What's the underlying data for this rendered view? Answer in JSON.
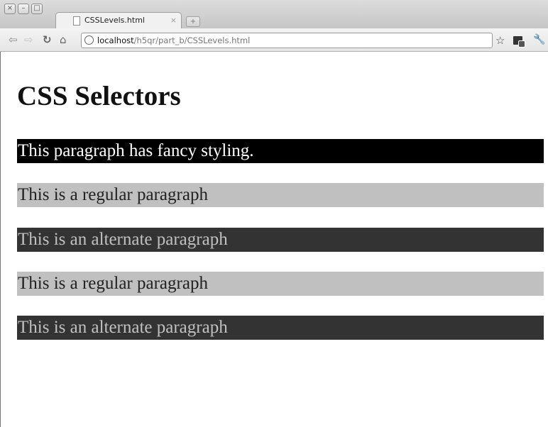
{
  "browser": {
    "tab_title": "CSSLevels.html",
    "tab_close": "×",
    "new_tab": "+",
    "url_host": "localhost",
    "url_path": "/h5qr/part_b/CSSLevels.html",
    "icons": [
      "close-window-icon",
      "minimize-window-icon",
      "maximize-window-icon",
      "page-icon",
      "back-arrow-icon",
      "forward-arrow-icon",
      "reload-icon",
      "home-icon",
      "globe-icon",
      "star-icon",
      "extension-icon",
      "wrench-icon"
    ]
  },
  "page": {
    "heading": "CSS Selectors",
    "paragraphs": [
      {
        "text": "This paragraph has fancy styling.",
        "bg": "#000000",
        "fg": "#ffffff"
      },
      {
        "text": "This is a regular paragraph",
        "bg": "#c0c0c0",
        "fg": "#222222"
      },
      {
        "text": "This is an alternate paragraph",
        "bg": "#333333",
        "fg": "#c0c0c0"
      },
      {
        "text": "This is a regular paragraph",
        "bg": "#c0c0c0",
        "fg": "#222222"
      },
      {
        "text": "This is an alternate paragraph",
        "bg": "#333333",
        "fg": "#c0c0c0"
      }
    ]
  }
}
